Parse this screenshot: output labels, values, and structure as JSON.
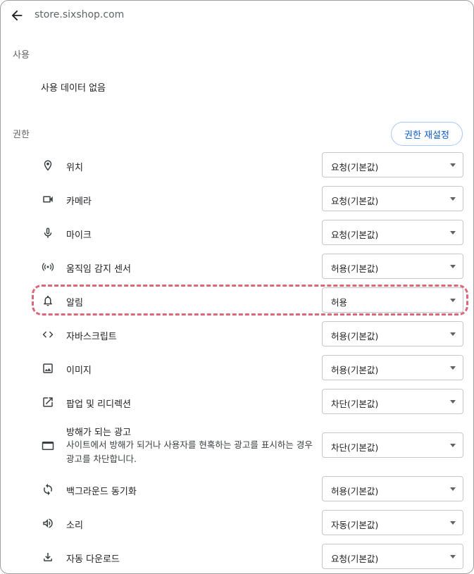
{
  "header": {
    "url": "store.sixshop.com",
    "back_icon": "arrow-left-icon"
  },
  "usage": {
    "section_label": "사용",
    "text": "사용 데이터 없음"
  },
  "permissions": {
    "section_label": "권한",
    "reset_button": "권한 재설정",
    "rows": [
      {
        "icon": "location-icon",
        "label": "위치",
        "value": "요청(기본값)"
      },
      {
        "icon": "camera-icon",
        "label": "카메라",
        "value": "요청(기본값)"
      },
      {
        "icon": "microphone-icon",
        "label": "마이크",
        "value": "요청(기본값)"
      },
      {
        "icon": "motion-sensor-icon",
        "label": "움직임 감지 센서",
        "value": "허용(기본값)"
      },
      {
        "icon": "bell-icon",
        "label": "알림",
        "value": "허용"
      },
      {
        "icon": "code-icon",
        "label": "자바스크립트",
        "value": "허용(기본값)"
      },
      {
        "icon": "image-icon",
        "label": "이미지",
        "value": "허용(기본값)"
      },
      {
        "icon": "popup-icon",
        "label": "팝업 및 리디렉션",
        "value": "차단(기본값)"
      },
      {
        "icon": "ads-icon",
        "label": "방해가 되는 광고",
        "description": "사이트에서 방해가 되거나 사용자를 현혹하는 광고를 표시하는 경우 광고를 차단합니다.",
        "value": "차단(기본값)"
      },
      {
        "icon": "sync-icon",
        "label": "백그라운드 동기화",
        "value": "허용(기본값)"
      },
      {
        "icon": "sound-icon",
        "label": "소리",
        "value": "자동(기본값)"
      },
      {
        "icon": "download-icon",
        "label": "자동 다운로드",
        "value": "요청(기본값)"
      }
    ]
  },
  "highlight_color": "#d9687a",
  "accent_color": "#0b57d0"
}
